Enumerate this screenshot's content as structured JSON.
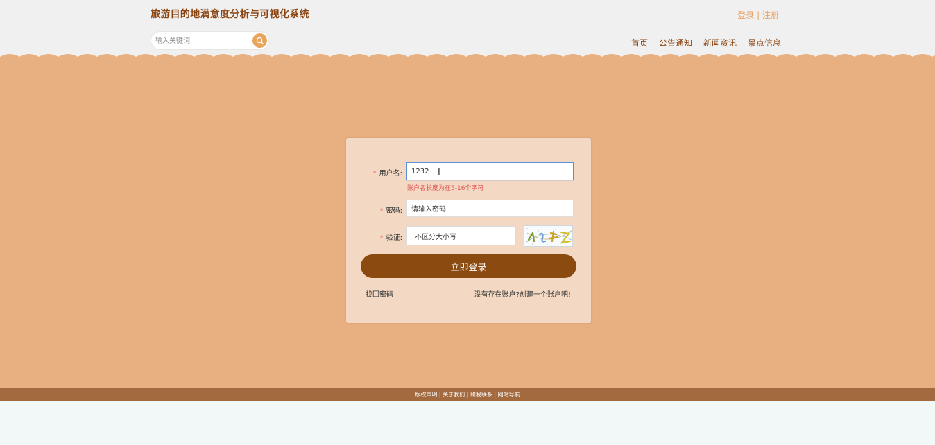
{
  "header": {
    "title": "旅游目的地满意度分析与可视化系统",
    "auth": {
      "login": "登录",
      "separator": " | ",
      "register": "注册"
    },
    "search": {
      "placeholder": "输入关键词",
      "value": ""
    },
    "nav": [
      "首页",
      "公告通知",
      "新闻资讯",
      "景点信息"
    ]
  },
  "login_form": {
    "username": {
      "label": "用户名:",
      "value": "1232",
      "error": "账户名长度为在5-16个字符"
    },
    "password": {
      "label": "密码:",
      "placeholder": "请输入密码"
    },
    "captcha": {
      "label": "验证:",
      "placeholder": "不区分大小写"
    },
    "submit_label": "立即登录",
    "forgot_label": "找回密码",
    "register_label": "没有存在账户?创建一个账户吧!"
  },
  "footer": {
    "text": "版权声明 | 关于我们 | 和我联系 | 网站导航"
  },
  "colors": {
    "header_bg": "#f0f0f0",
    "main_bg": "#e8b080",
    "card_bg": "#f3d9c3",
    "brand_brown": "#8b4513",
    "button_bg": "#8b4a10",
    "accent_orange": "#e9a45e",
    "error": "#e05555",
    "footer_bg": "#a36a40"
  }
}
